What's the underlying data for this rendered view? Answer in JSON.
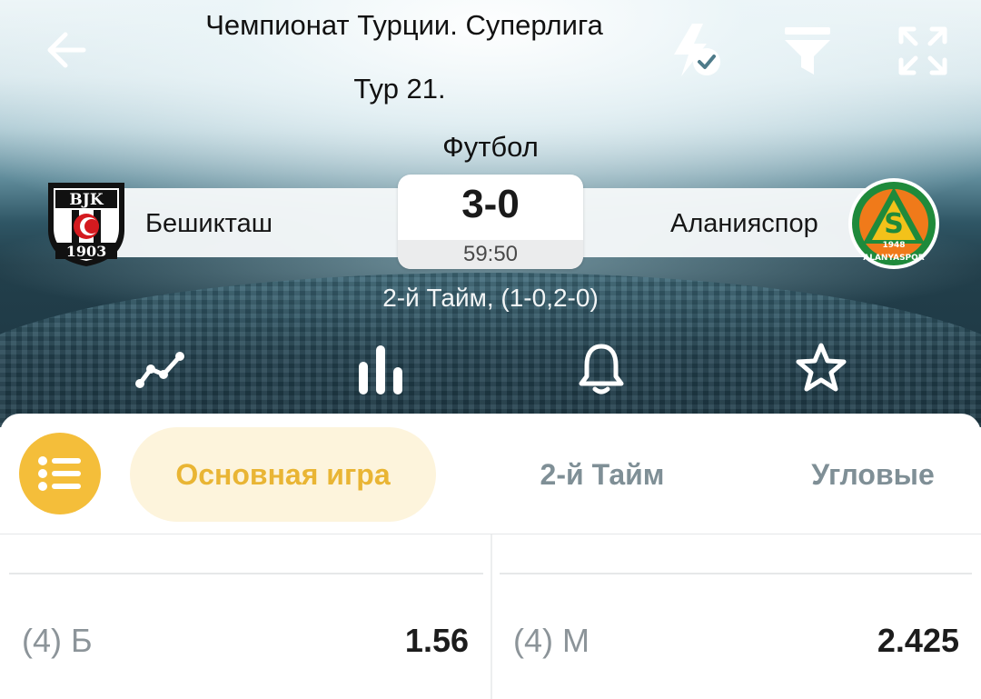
{
  "header": {
    "league": "Чемпионат Турции. Суперлига",
    "round": "Тур 21.",
    "sport": "Футбол",
    "home_team": "Бешикташ",
    "away_team": "Аланияспор",
    "score": "3-0",
    "clock": "59:50",
    "period": "2-й Тайм, (1-0,2-0)",
    "home_crest": {
      "line1": "BJK",
      "line2": "1903"
    },
    "away_crest": {
      "letter": "S",
      "year": "1948",
      "name": "ALANYASPOR"
    }
  },
  "toolbar": {
    "back_icon": "arrow-left-icon",
    "quick_bet_icon": "lightning-check-icon",
    "filter_icon": "filter-icon",
    "fullscreen_icon": "expand-icon"
  },
  "actions": [
    {
      "icon": "line-chart-icon"
    },
    {
      "icon": "bar-stats-icon"
    },
    {
      "icon": "bell-icon"
    },
    {
      "icon": "star-icon"
    }
  ],
  "tabs": {
    "menu_icon": "list-menu-icon",
    "items": [
      {
        "label": "Основная игра",
        "active": true
      },
      {
        "label": "2-й Тайм",
        "active": false
      },
      {
        "label": "Угловые",
        "active": false
      }
    ]
  },
  "odds": {
    "rows": [
      {
        "left_label": "(4) Б",
        "left_value": "1.56",
        "right_label": "(4) М",
        "right_value": "2.425"
      }
    ]
  },
  "colors": {
    "accent": "#f4be3a",
    "accent_text": "#e9b534",
    "active_tab_bg": "#fdf4dc",
    "inactive_tab": "#7f8f96"
  }
}
